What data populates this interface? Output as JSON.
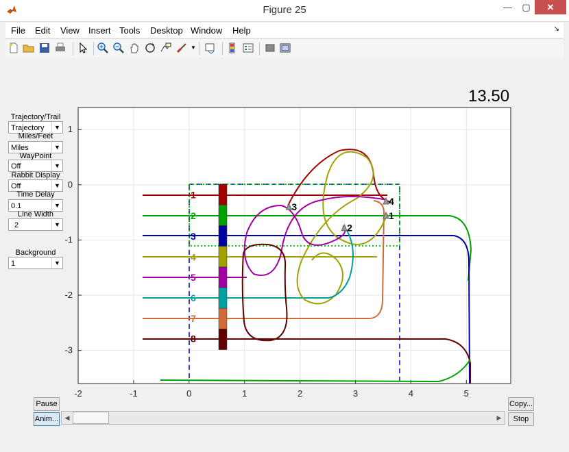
{
  "window": {
    "title": "Figure 25",
    "minimize": "—",
    "maximize": "▢",
    "close": "✕"
  },
  "menu": [
    "File",
    "Edit",
    "View",
    "Insert",
    "Tools",
    "Desktop",
    "Window",
    "Help"
  ],
  "toolbar_icons": [
    "new-figure-icon",
    "open-file-icon",
    "save-icon",
    "print-icon",
    "pointer-icon",
    "zoom-in-icon",
    "zoom-out-icon",
    "pan-icon",
    "rotate-icon",
    "data-cursor-icon",
    "brush-icon",
    "link-plot-icon",
    "colorbar-icon",
    "legend-icon",
    "hide-plot-tools-icon",
    "show-plot-tools-icon"
  ],
  "controls": {
    "trajectory_label": "Trajectory/Trail",
    "trajectory_value": "Trajectory",
    "units_label": "Miles/Feet",
    "units_value": "Miles",
    "waypoint_label": "WayPoint",
    "waypoint_value": "Off",
    "rabbit_label": "Rabbit Display",
    "rabbit_value": "Off",
    "delay_label": "Time Delay",
    "delay_value": "0.1",
    "linewidth_label": "Line Width",
    "linewidth_value": "2",
    "background_label": "Background",
    "background_value": "1"
  },
  "buttons": {
    "pause": "Pause",
    "anim": "Anim...",
    "copy": "Copy...",
    "stop": "Stop"
  },
  "timer": "13.50",
  "chart_data": {
    "type": "line",
    "xlim": [
      -2,
      5.8
    ],
    "ylim": [
      -3.6,
      1.4
    ],
    "xticks": [
      "-2",
      "-1",
      "0",
      "1",
      "2",
      "3",
      "4",
      "5"
    ],
    "yticks": [
      "1",
      "0",
      "-1",
      "-2",
      "-3"
    ],
    "grid": true,
    "series": [
      {
        "label": "1",
        "color": "#a00000",
        "y": -0.18
      },
      {
        "label": "2",
        "color": "#00a000",
        "y": -0.56
      },
      {
        "label": "3",
        "color": "#0000a0",
        "y": -0.93
      },
      {
        "label": "4",
        "color": "#a0a000",
        "y": -1.31
      },
      {
        "label": "5",
        "color": "#a000a0",
        "y": -1.68
      },
      {
        "label": "6",
        "color": "#00a0a0",
        "y": -2.05
      },
      {
        "label": "7",
        "color": "#d06c3a",
        "y": -2.42
      },
      {
        "label": "8",
        "color": "#600000",
        "y": -2.79
      }
    ],
    "markers": [
      {
        "label": "1",
        "x": 3.55,
        "y": -0.56
      },
      {
        "label": "2",
        "x": 2.8,
        "y": -0.78
      },
      {
        "label": "3",
        "x": 1.8,
        "y": -0.4
      },
      {
        "label": "4",
        "x": 3.55,
        "y": -0.3
      }
    ]
  }
}
